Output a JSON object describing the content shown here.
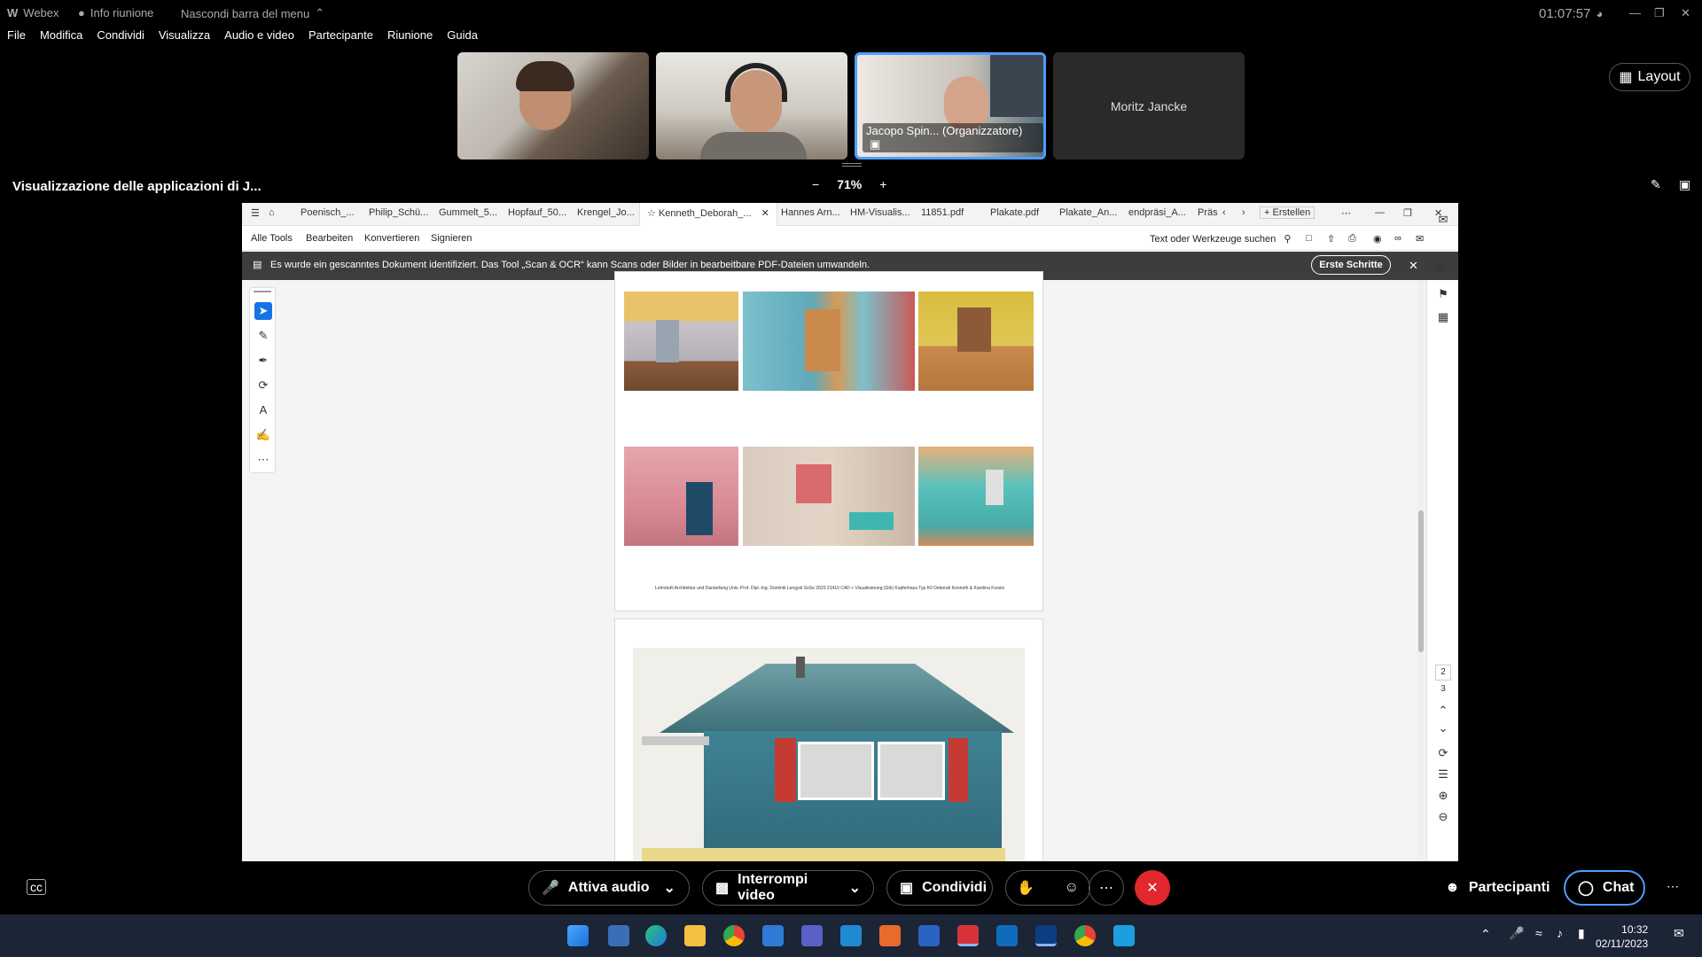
{
  "webex": {
    "app_name": "Webex",
    "meeting_info": "Info riunione",
    "hide_menu": "Nascondi barra del menu",
    "timer": "01:07:57",
    "menu": [
      "File",
      "Modifica",
      "Condividi",
      "Visualizza",
      "Audio e video",
      "Partecipante",
      "Riunione",
      "Guida"
    ],
    "participants": [
      {
        "name": ""
      },
      {
        "name": ""
      },
      {
        "name": "Jacopo Spin... (Organizzatore)"
      },
      {
        "name": "Moritz Jancke"
      }
    ],
    "layout_label": "Layout",
    "share_title": "Visualizzazione delle applicazioni di J...",
    "zoom_minus": "−",
    "zoom_level": "71%",
    "zoom_plus": "+",
    "controls": {
      "audio": "Attiva audio",
      "video": "Interrompi video",
      "share": "Condividi",
      "participants": "Partecipanti",
      "chat": "Chat"
    }
  },
  "acrobat": {
    "tabs": [
      "Poenisch_...",
      "Philip_Schü...",
      "Gummelt_5...",
      "Hopfauf_50...",
      "Krengel_Jo...",
      "Kenneth_Deborah_...",
      "Hannes Arn...",
      "HM-Visualis...",
      "11851.pdf",
      "Plakate.pdf",
      "Plakate_An...",
      "endpräsi_A...",
      "Präs"
    ],
    "create_label": "Erstellen",
    "menu": [
      "Alle Tools",
      "Bearbeiten",
      "Konvertieren",
      "Signieren"
    ],
    "search_label": "Text oder Werkzeuge suchen",
    "banner_msg": "Es wurde ein gescanntes Dokument identifiziert. Das Tool „Scan & OCR“ kann Scans oder Bilder in bearbeitbare PDF-Dateien umwandeln.",
    "banner_cta": "Erste Schritte",
    "page_caption": "Lehrstuhl Architektur und Darstellung Univ.-Prof. Dipl.-Ing. Dominik Lengyel SoSe 2023 21410 CAD + Visualisierung (Gib) Kupferhaus Typ K0 Deborah Kenneth & Karolina Fuseis",
    "page_numbers": [
      "2",
      "3"
    ]
  },
  "taskbar": {
    "time": "10:32",
    "date": "02/11/2023"
  },
  "colors": {
    "accent": "#1473e6",
    "end_call": "#e0282e",
    "active_tile": "#4d9fff"
  }
}
